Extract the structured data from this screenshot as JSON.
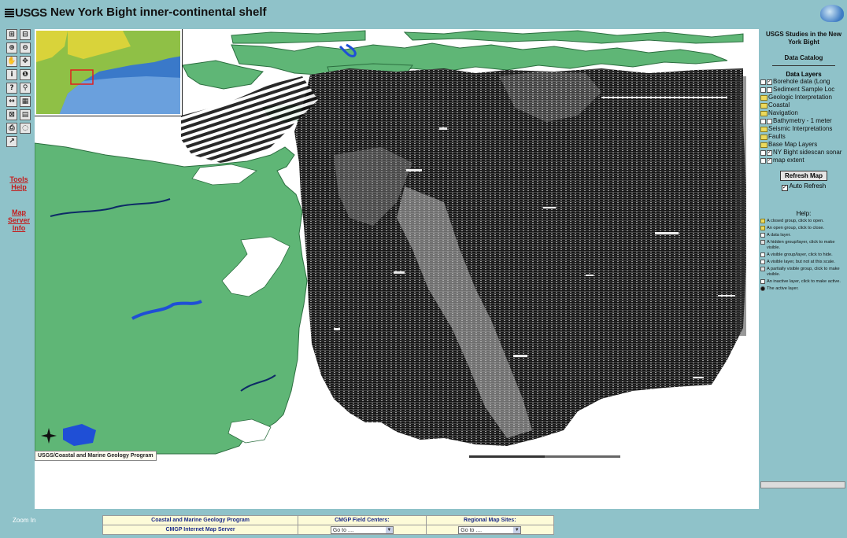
{
  "header": {
    "logo": "USGS",
    "title": "New York Bight inner-continental shelf"
  },
  "toolbar": {
    "tools": [
      "zoom-in",
      "zoom-out",
      "zoom-full",
      "zoom-last",
      "pan",
      "pan-center",
      "identify",
      "info",
      "query",
      "find",
      "measure",
      "select",
      "clear",
      "legend",
      "print",
      "buffer",
      "hyperlink",
      "print-map"
    ],
    "tool_glyphs": [
      "⊞",
      "⊟",
      "⊕",
      "⊖",
      "✋",
      "✥",
      "i",
      "❶",
      "?",
      "⚲",
      "↔",
      "▦",
      "⊠",
      "▤",
      "⎙",
      "◌",
      "↗",
      "✎"
    ],
    "tools_help_label": "Tools Help",
    "map_server_info_label": "Map Server Info"
  },
  "map": {
    "credit": "USGS/Coastal and Marine Geology Program"
  },
  "right_panel": {
    "title": "USGS Studies in the New York Bight",
    "catalog": "Data Catalog",
    "layers_title": "Data Layers",
    "layers": [
      {
        "label": "Borehole data (Long",
        "kind": "doc",
        "checked": true
      },
      {
        "label": "Sediment Sample Loc",
        "kind": "doc",
        "checked": false
      },
      {
        "label": "Geologic Interpretation",
        "kind": "folder",
        "checked": false
      },
      {
        "label": "Coastal",
        "kind": "folder",
        "checked": false
      },
      {
        "label": "Navigation",
        "kind": "folder",
        "checked": false
      },
      {
        "label": "Bathymetry - 1 meter",
        "kind": "doc",
        "checked": false
      },
      {
        "label": "Seismic Interpretations",
        "kind": "folder",
        "checked": false
      },
      {
        "label": "Faults",
        "kind": "folder",
        "checked": false
      },
      {
        "label": "Base Map Layers",
        "kind": "folder",
        "checked": false
      },
      {
        "label": "NY Bight sidescan sonar",
        "kind": "doc",
        "checked": true
      },
      {
        "label": "map extent",
        "kind": "doc",
        "checked": true
      }
    ],
    "refresh_label": "Refresh Map",
    "auto_refresh_label": "Auto Refresh",
    "help_title": "Help:",
    "help_items": [
      "A closed group, click to open.",
      "An open group, click to close.",
      "A data layer.",
      "A hidden group/layer, click to make visible.",
      "A visible group/layer, click to hide.",
      "A visible layer, but not at this scale.",
      "A partially visible group, click to make visible.",
      "An inactive layer, click to make active.",
      "The active layer."
    ]
  },
  "bottom": {
    "zoom_label": "Zoom In",
    "cmgp_link": "Coastal and Marine Geology Program",
    "ims_link": "CMGP Internet Map Server",
    "field_centers_label": "CMGP Field Centers:",
    "regional_label": "Regional Map Sites:",
    "goto_text": "Go to ...."
  },
  "colors": {
    "background": "#8fc2c9",
    "land": "#5fb676",
    "water_blue": "#1f4fd6",
    "link_red": "#c41d1d"
  }
}
